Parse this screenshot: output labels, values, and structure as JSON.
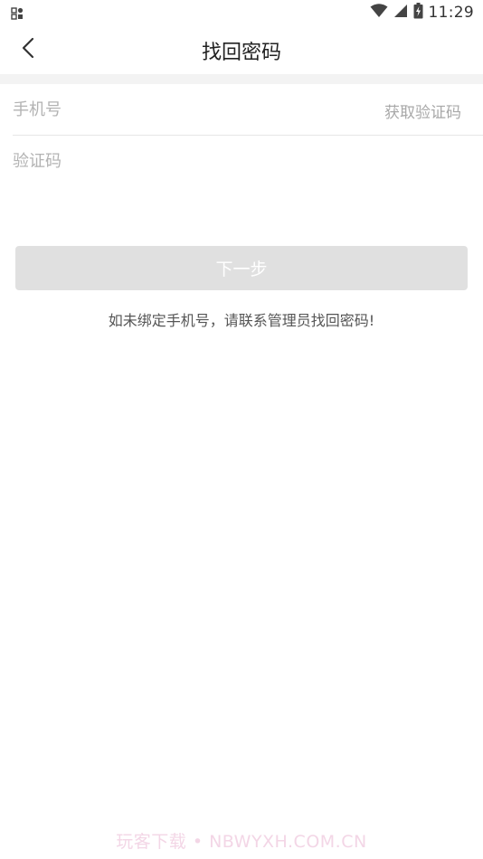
{
  "status_bar": {
    "time": "11:29",
    "left_icon": "notification-grid-icon",
    "icons": [
      "wifi-icon",
      "signal-icon",
      "battery-icon"
    ]
  },
  "nav": {
    "back_icon": "chevron-left-icon",
    "title": "找回密码"
  },
  "form": {
    "phone_placeholder": "手机号",
    "phone_value": "",
    "get_code_label": "获取验证码",
    "code_placeholder": "验证码",
    "code_value": ""
  },
  "next_button_label": "下一步",
  "hint": "如未绑定手机号，请联系管理员找回密码!",
  "watermark": "玩客下载 • NBWYXH.COM.CN",
  "colors": {
    "button_disabled_bg": "#e0e0e0",
    "divider_band": "#f3f3f3",
    "placeholder": "#b3b3b3"
  }
}
